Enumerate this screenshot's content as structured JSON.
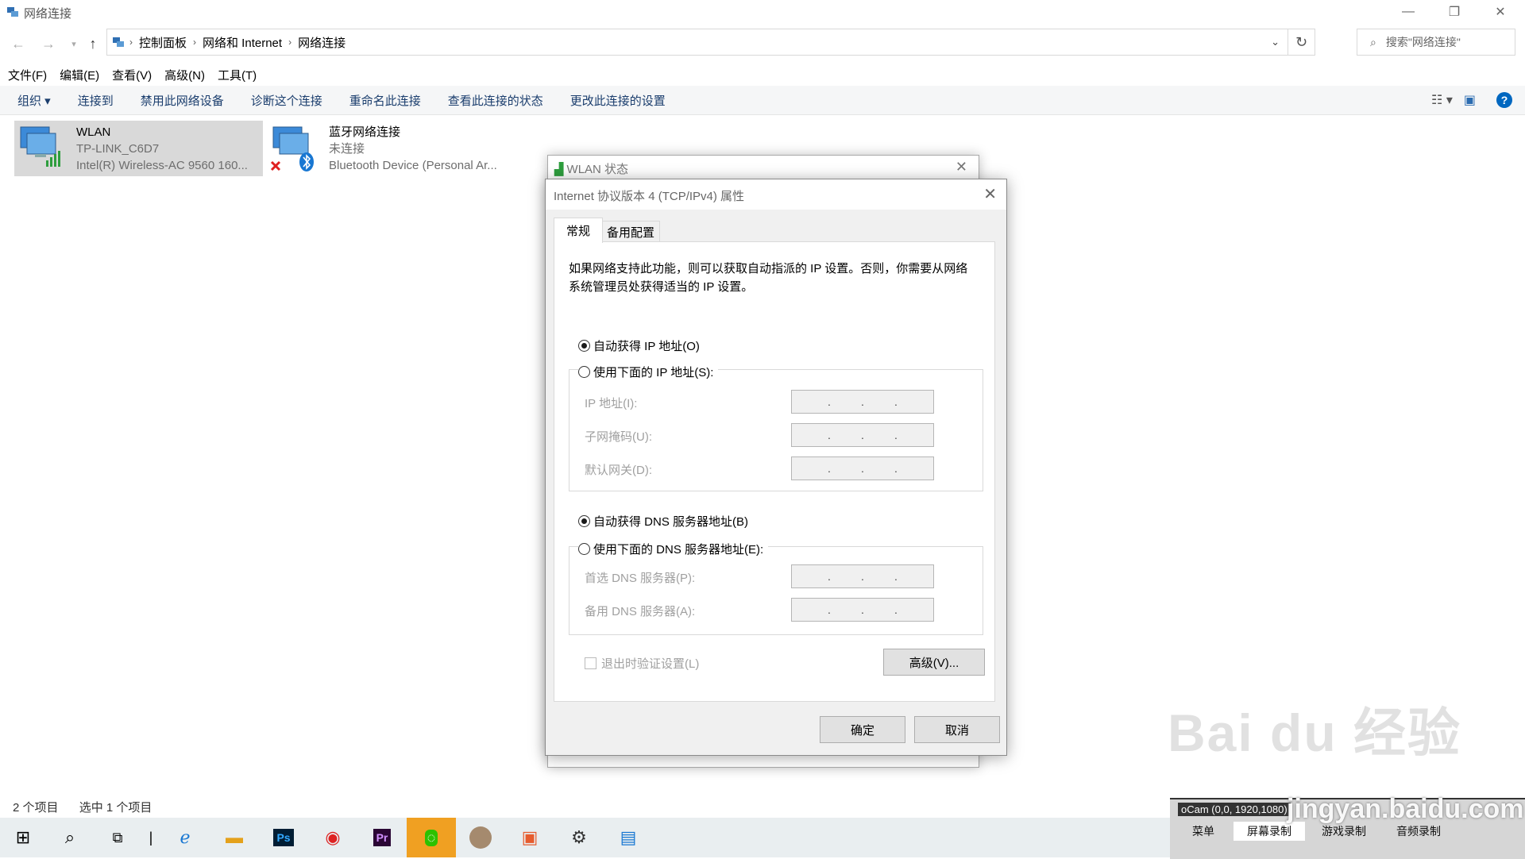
{
  "window": {
    "title": "网络连接",
    "controls": [
      "minimize-icon",
      "restore-icon",
      "close-icon"
    ]
  },
  "address": {
    "crumbs": [
      "控制面板",
      "网络和 Internet",
      "网络连接"
    ],
    "search_placeholder": "搜索\"网络连接\""
  },
  "menu": [
    "文件(F)",
    "编辑(E)",
    "查看(V)",
    "高级(N)",
    "工具(T)"
  ],
  "commands": [
    "组织 ▾",
    "连接到",
    "禁用此网络设备",
    "诊断这个连接",
    "重命名此连接",
    "查看此连接的状态",
    "更改此连接的设置"
  ],
  "connections": [
    {
      "name": "WLAN",
      "line1": "TP-LINK_C6D7",
      "line2": "Intel(R) Wireless-AC 9560 160..."
    },
    {
      "name": "蓝牙网络连接",
      "line1": "未连接",
      "line2": "Bluetooth Device (Personal Ar..."
    }
  ],
  "statusbar": {
    "count": "2 个项目",
    "selected": "选中 1 个项目"
  },
  "back_dialog": {
    "title": "WLAN 状态"
  },
  "dialog": {
    "title": "Internet 协议版本 4 (TCP/IPv4) 属性",
    "tabs": [
      "常规",
      "备用配置"
    ],
    "intro": "如果网络支持此功能，则可以获取自动指派的 IP 设置。否则，你需要从网络系统管理员处获得适当的 IP 设置。",
    "ip_auto": "自动获得 IP 地址(O)",
    "ip_manual": "使用下面的 IP 地址(S):",
    "ip_fields": [
      "IP 地址(I):",
      "子网掩码(U):",
      "默认网关(D):"
    ],
    "dns_auto": "自动获得 DNS 服务器地址(B)",
    "dns_manual": "使用下面的 DNS 服务器地址(E):",
    "dns_fields": [
      "首选 DNS 服务器(P):",
      "备用 DNS 服务器(A):"
    ],
    "validate": "退出时验证设置(L)",
    "advanced": "高级(V)...",
    "ok": "确定",
    "cancel": "取消"
  },
  "recorder": {
    "title": "oCam (0,0, 1920,1080)",
    "tabs": [
      "菜单",
      "屏幕录制",
      "游戏录制",
      "音频录制"
    ]
  },
  "watermark": {
    "brand": "Bai du 经验",
    "url": "jingyan.baidu.com"
  },
  "colors": {
    "accent": "#0078d7",
    "link": "#1a3d6d",
    "selection": "#cce8ff"
  }
}
